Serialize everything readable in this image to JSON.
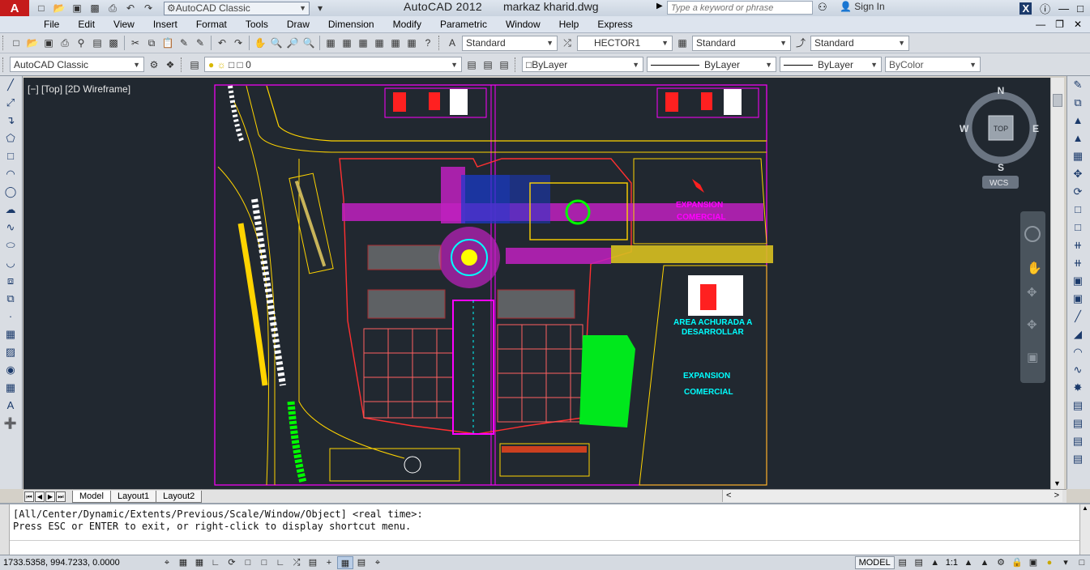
{
  "titlebar": {
    "logo": "A",
    "workspace": "AutoCAD Classic",
    "app_title": "AutoCAD 2012",
    "file_name": "markaz kharid.dwg",
    "search_placeholder": "Type a keyword or phrase",
    "sign_in": "Sign In"
  },
  "menubar": {
    "items": [
      "File",
      "Edit",
      "View",
      "Insert",
      "Format",
      "Tools",
      "Draw",
      "Dimension",
      "Modify",
      "Parametric",
      "Window",
      "Help",
      "Express"
    ]
  },
  "toolbar1": {
    "text_style": "Standard",
    "dim_style": "HECTOR1",
    "table_style": "Standard",
    "multileader_style": "Standard"
  },
  "toolbar2": {
    "workspace": "AutoCAD Classic",
    "layer": "0",
    "color": "ByLayer",
    "linetype": "ByLayer",
    "lineweight": "ByLayer",
    "plotstyle": "ByColor"
  },
  "viewport": {
    "label": "[−] [Top] [2D Wireframe]"
  },
  "viewcube": {
    "north": "N",
    "south": "S",
    "east": "E",
    "west": "W",
    "face": "TOP",
    "ucs": "WCS"
  },
  "drawing": {
    "text1": "EXPANSION",
    "text2": "COMERCIAL",
    "text3": "AREA ACHURADA A",
    "text4": "DESARROLLAR",
    "text5": "EXPANSION",
    "text6": "COMERCIAL"
  },
  "tabs": {
    "model": "Model",
    "layout1": "Layout1",
    "layout2": "Layout2"
  },
  "command": {
    "line1": "[All/Center/Dynamic/Extents/Previous/Scale/Window/Object] <real time>:",
    "line2": "Press ESC or ENTER to exit, or right-click to display shortcut menu."
  },
  "status": {
    "coordinates": "1733.5358, 994.7233, 0.0000",
    "model": "MODEL",
    "annotation_scale": "1:1"
  },
  "colors": {
    "canvas": "#212830",
    "magenta": "#ff00ff",
    "yellow": "#ffd400",
    "cyan": "#00ffff",
    "green": "#00ff00",
    "red": "#ff2020"
  }
}
